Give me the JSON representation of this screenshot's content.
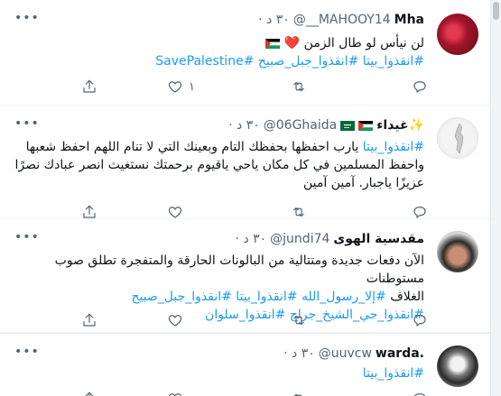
{
  "tweets": [
    {
      "name": "Mha",
      "handle": "@__MAHOOY14",
      "time": "٣٠ د",
      "lines": [
        [
          {
            "t": "لن نيأس لو طال الزمن ",
            "h": false
          },
          {
            "t": "❤️",
            "h": false
          }
        ],
        [
          {
            "t": "#انقذوا_بيتا",
            "h": true
          },
          {
            "t": " ",
            "h": false
          },
          {
            "t": "#انقذوا_جبل_صبيح",
            "h": true
          },
          {
            "t": " ",
            "h": false
          },
          {
            "t": "#SavePalestine",
            "h": true
          }
        ]
      ],
      "like_count": "١"
    },
    {
      "name": "غيداء",
      "handle": "@06Ghaida",
      "time": "٣٠ د",
      "lines": [
        [
          {
            "t": "#انقذوا_بيتا",
            "h": true
          },
          {
            "t": " يارب احفظها بحفظك التام وبعينك التي لا تنام اللهم احفظ شعبها",
            "h": false
          }
        ],
        [
          {
            "t": "واحفظ المسلمين في كل مكان ياحي ياقيوم برحمتك نستغيث انصر عبادك نصرًا",
            "h": false
          }
        ],
        [
          {
            "t": "عزيزًا ياجبار. آمين آمين",
            "h": false
          }
        ]
      ],
      "like_count": ""
    },
    {
      "name": "مقدسية الهوى",
      "handle": "@jundi74",
      "time": "٣٠ د",
      "lines": [
        [
          {
            "t": "الآن دفعات جديدة ومتتالية من البالونات الحارقة والمتفجرة تطلق صوب مستوطنات",
            "h": false
          }
        ],
        [
          {
            "t": "الغلاف ",
            "h": false
          },
          {
            "t": "#إلا_رسول_الله",
            "h": true
          },
          {
            "t": " ",
            "h": false
          },
          {
            "t": "#انقذوا_بيتا",
            "h": true
          },
          {
            "t": " ",
            "h": false
          },
          {
            "t": "#انقذوا_جبل_صبيح",
            "h": true
          }
        ],
        [
          {
            "t": "#انقذوا_حي_الشيخ_جراح",
            "h": true
          },
          {
            "t": " ",
            "h": false
          },
          {
            "t": "#انقذوا_سلوان",
            "h": true
          }
        ]
      ],
      "like_count": ""
    },
    {
      "name": "warda.",
      "handle": "@uuvcw",
      "time": "٣٠ د",
      "lines": [
        [
          {
            "t": "#انقذوا_بيتا",
            "h": true
          }
        ]
      ],
      "like_count": ""
    }
  ],
  "icons": {
    "more": "more-icon",
    "reply": "reply-icon",
    "retweet": "retweet-icon",
    "like": "like-icon",
    "share": "share-icon"
  },
  "colors": {
    "accent": "#1d9bf0",
    "muted": "#536471",
    "text": "#0f1419"
  }
}
